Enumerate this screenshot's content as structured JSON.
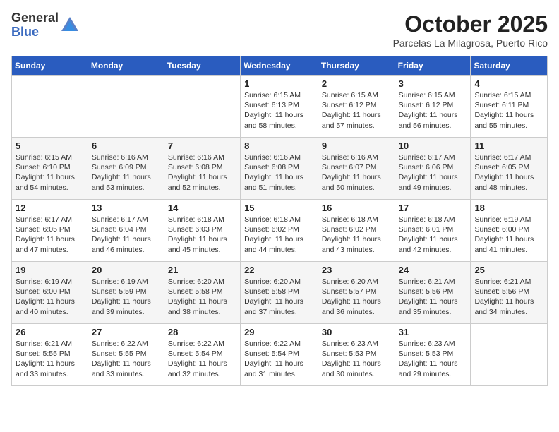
{
  "logo": {
    "general": "General",
    "blue": "Blue"
  },
  "header": {
    "month": "October 2025",
    "location": "Parcelas La Milagrosa, Puerto Rico"
  },
  "weekdays": [
    "Sunday",
    "Monday",
    "Tuesday",
    "Wednesday",
    "Thursday",
    "Friday",
    "Saturday"
  ],
  "weeks": [
    [
      {
        "day": "",
        "info": ""
      },
      {
        "day": "",
        "info": ""
      },
      {
        "day": "",
        "info": ""
      },
      {
        "day": "1",
        "info": "Sunrise: 6:15 AM\nSunset: 6:13 PM\nDaylight: 11 hours\nand 58 minutes."
      },
      {
        "day": "2",
        "info": "Sunrise: 6:15 AM\nSunset: 6:12 PM\nDaylight: 11 hours\nand 57 minutes."
      },
      {
        "day": "3",
        "info": "Sunrise: 6:15 AM\nSunset: 6:12 PM\nDaylight: 11 hours\nand 56 minutes."
      },
      {
        "day": "4",
        "info": "Sunrise: 6:15 AM\nSunset: 6:11 PM\nDaylight: 11 hours\nand 55 minutes."
      }
    ],
    [
      {
        "day": "5",
        "info": "Sunrise: 6:15 AM\nSunset: 6:10 PM\nDaylight: 11 hours\nand 54 minutes."
      },
      {
        "day": "6",
        "info": "Sunrise: 6:16 AM\nSunset: 6:09 PM\nDaylight: 11 hours\nand 53 minutes."
      },
      {
        "day": "7",
        "info": "Sunrise: 6:16 AM\nSunset: 6:08 PM\nDaylight: 11 hours\nand 52 minutes."
      },
      {
        "day": "8",
        "info": "Sunrise: 6:16 AM\nSunset: 6:08 PM\nDaylight: 11 hours\nand 51 minutes."
      },
      {
        "day": "9",
        "info": "Sunrise: 6:16 AM\nSunset: 6:07 PM\nDaylight: 11 hours\nand 50 minutes."
      },
      {
        "day": "10",
        "info": "Sunrise: 6:17 AM\nSunset: 6:06 PM\nDaylight: 11 hours\nand 49 minutes."
      },
      {
        "day": "11",
        "info": "Sunrise: 6:17 AM\nSunset: 6:05 PM\nDaylight: 11 hours\nand 48 minutes."
      }
    ],
    [
      {
        "day": "12",
        "info": "Sunrise: 6:17 AM\nSunset: 6:05 PM\nDaylight: 11 hours\nand 47 minutes."
      },
      {
        "day": "13",
        "info": "Sunrise: 6:17 AM\nSunset: 6:04 PM\nDaylight: 11 hours\nand 46 minutes."
      },
      {
        "day": "14",
        "info": "Sunrise: 6:18 AM\nSunset: 6:03 PM\nDaylight: 11 hours\nand 45 minutes."
      },
      {
        "day": "15",
        "info": "Sunrise: 6:18 AM\nSunset: 6:02 PM\nDaylight: 11 hours\nand 44 minutes."
      },
      {
        "day": "16",
        "info": "Sunrise: 6:18 AM\nSunset: 6:02 PM\nDaylight: 11 hours\nand 43 minutes."
      },
      {
        "day": "17",
        "info": "Sunrise: 6:18 AM\nSunset: 6:01 PM\nDaylight: 11 hours\nand 42 minutes."
      },
      {
        "day": "18",
        "info": "Sunrise: 6:19 AM\nSunset: 6:00 PM\nDaylight: 11 hours\nand 41 minutes."
      }
    ],
    [
      {
        "day": "19",
        "info": "Sunrise: 6:19 AM\nSunset: 6:00 PM\nDaylight: 11 hours\nand 40 minutes."
      },
      {
        "day": "20",
        "info": "Sunrise: 6:19 AM\nSunset: 5:59 PM\nDaylight: 11 hours\nand 39 minutes."
      },
      {
        "day": "21",
        "info": "Sunrise: 6:20 AM\nSunset: 5:58 PM\nDaylight: 11 hours\nand 38 minutes."
      },
      {
        "day": "22",
        "info": "Sunrise: 6:20 AM\nSunset: 5:58 PM\nDaylight: 11 hours\nand 37 minutes."
      },
      {
        "day": "23",
        "info": "Sunrise: 6:20 AM\nSunset: 5:57 PM\nDaylight: 11 hours\nand 36 minutes."
      },
      {
        "day": "24",
        "info": "Sunrise: 6:21 AM\nSunset: 5:56 PM\nDaylight: 11 hours\nand 35 minutes."
      },
      {
        "day": "25",
        "info": "Sunrise: 6:21 AM\nSunset: 5:56 PM\nDaylight: 11 hours\nand 34 minutes."
      }
    ],
    [
      {
        "day": "26",
        "info": "Sunrise: 6:21 AM\nSunset: 5:55 PM\nDaylight: 11 hours\nand 33 minutes."
      },
      {
        "day": "27",
        "info": "Sunrise: 6:22 AM\nSunset: 5:55 PM\nDaylight: 11 hours\nand 33 minutes."
      },
      {
        "day": "28",
        "info": "Sunrise: 6:22 AM\nSunset: 5:54 PM\nDaylight: 11 hours\nand 32 minutes."
      },
      {
        "day": "29",
        "info": "Sunrise: 6:22 AM\nSunset: 5:54 PM\nDaylight: 11 hours\nand 31 minutes."
      },
      {
        "day": "30",
        "info": "Sunrise: 6:23 AM\nSunset: 5:53 PM\nDaylight: 11 hours\nand 30 minutes."
      },
      {
        "day": "31",
        "info": "Sunrise: 6:23 AM\nSunset: 5:53 PM\nDaylight: 11 hours\nand 29 minutes."
      },
      {
        "day": "",
        "info": ""
      }
    ]
  ]
}
